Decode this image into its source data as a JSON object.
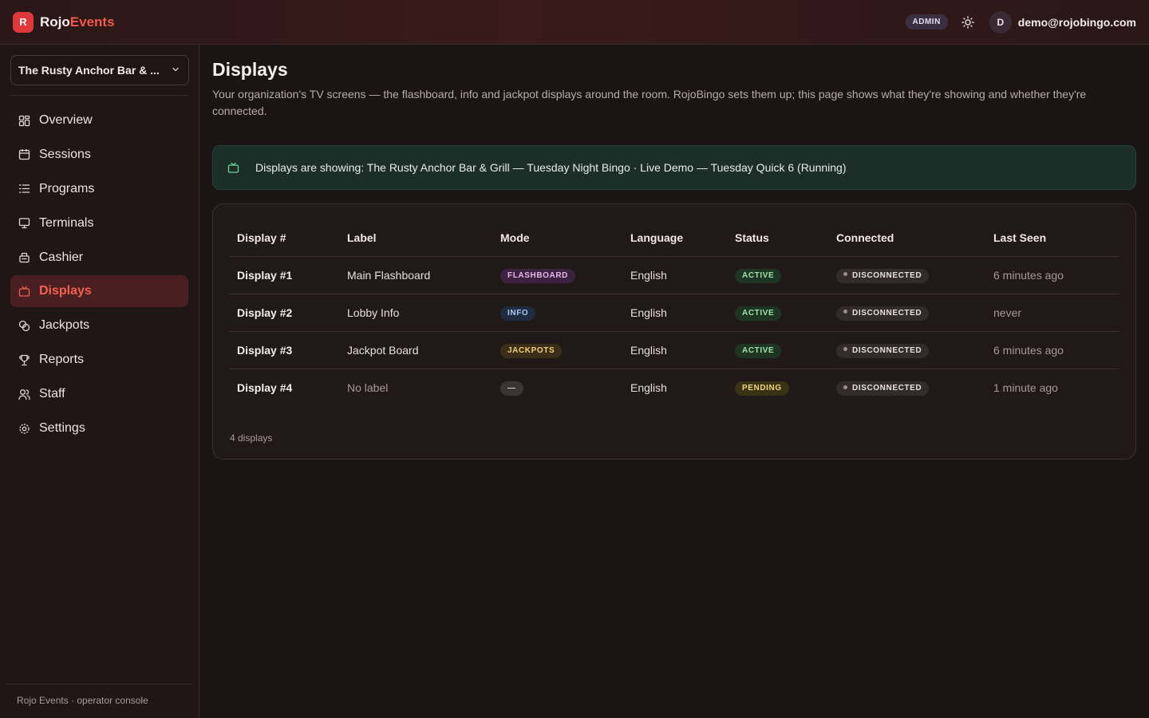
{
  "app": {
    "logo_letter": "R",
    "brand_part1": "Rojo",
    "brand_part2": "Events",
    "role_badge": "ADMIN",
    "avatar_initial": "D",
    "user_email": "demo@rojobingo.com"
  },
  "sidebar": {
    "org_selector": "The Rusty Anchor Bar & ...",
    "items": [
      {
        "label": "Overview",
        "icon": "grid-icon"
      },
      {
        "label": "Sessions",
        "icon": "calendar-icon"
      },
      {
        "label": "Programs",
        "icon": "list-icon"
      },
      {
        "label": "Terminals",
        "icon": "monitor-icon"
      },
      {
        "label": "Cashier",
        "icon": "cashier-icon"
      },
      {
        "label": "Displays",
        "icon": "tv-icon",
        "active": true
      },
      {
        "label": "Jackpots",
        "icon": "coins-icon"
      },
      {
        "label": "Reports",
        "icon": "trophy-icon"
      },
      {
        "label": "Staff",
        "icon": "users-icon"
      },
      {
        "label": "Settings",
        "icon": "gear-icon"
      }
    ],
    "footer": "Rojo Events · operator console"
  },
  "page": {
    "title": "Displays",
    "description": "Your organization's TV screens — the flashboard, info and jackpot displays around the room. RojoBingo sets them up; this page shows what they're showing and whether they're connected.",
    "banner": "Displays are showing: The Rusty Anchor Bar & Grill — Tuesday Night Bingo · Live Demo — Tuesday Quick 6 (Running)"
  },
  "table": {
    "headers": [
      "Display #",
      "Label",
      "Mode",
      "Language",
      "Status",
      "Connected",
      "Last Seen"
    ],
    "rows": [
      {
        "display": "Display #1",
        "label": "Main Flashboard",
        "mode": "FLASHBOARD",
        "language": "English",
        "status": "ACTIVE",
        "connected": "DISCONNECTED",
        "last_seen": "6 minutes ago"
      },
      {
        "display": "Display #2",
        "label": "Lobby Info",
        "mode": "INFO",
        "language": "English",
        "status": "ACTIVE",
        "connected": "DISCONNECTED",
        "last_seen": "never"
      },
      {
        "display": "Display #3",
        "label": "Jackpot Board",
        "mode": "JACKPOTS",
        "language": "English",
        "status": "ACTIVE",
        "connected": "DISCONNECTED",
        "last_seen": "6 minutes ago"
      },
      {
        "display": "Display #4",
        "label": "No label",
        "mode": "—",
        "language": "English",
        "status": "PENDING",
        "connected": "DISCONNECTED",
        "last_seen": "1 minute ago"
      }
    ],
    "count": "4 displays"
  }
}
